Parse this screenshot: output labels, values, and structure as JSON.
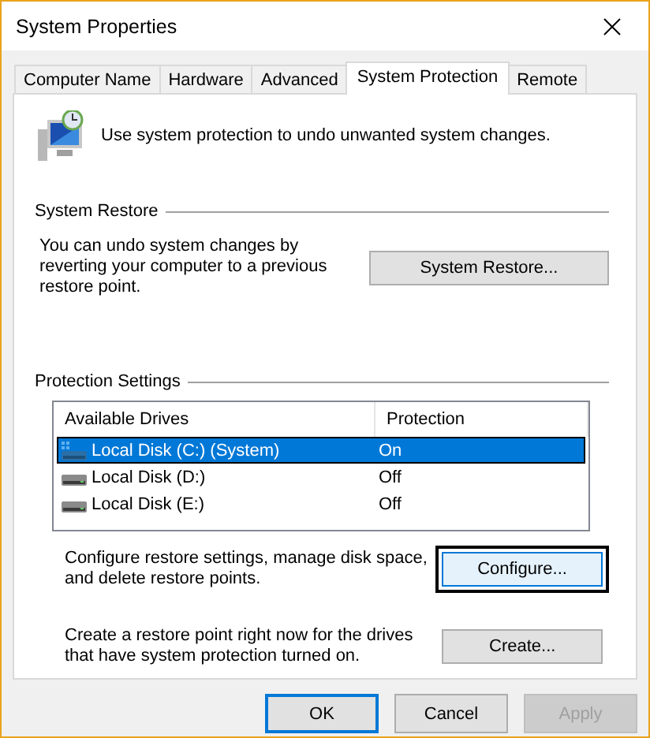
{
  "window": {
    "title": "System Properties"
  },
  "tabs": [
    {
      "label": "Computer Name",
      "selected": false
    },
    {
      "label": "Hardware",
      "selected": false
    },
    {
      "label": "Advanced",
      "selected": false
    },
    {
      "label": "System Protection",
      "selected": true
    },
    {
      "label": "Remote",
      "selected": false
    }
  ],
  "intro": "Use system protection to undo unwanted system changes.",
  "system_restore": {
    "heading": "System Restore",
    "description": "You can undo system changes by reverting your computer to a previous restore point.",
    "button": "System Restore..."
  },
  "protection_settings": {
    "heading": "Protection Settings",
    "columns": [
      "Available Drives",
      "Protection"
    ],
    "drives": [
      {
        "name": "Local Disk (C:) (System)",
        "protection": "On",
        "selected": true,
        "kind": "system"
      },
      {
        "name": "Local Disk (D:)",
        "protection": "Off",
        "selected": false,
        "kind": "disk"
      },
      {
        "name": "Local Disk (E:)",
        "protection": "Off",
        "selected": false,
        "kind": "disk"
      }
    ],
    "configure": {
      "description": "Configure restore settings, manage disk space, and delete restore points.",
      "button": "Configure...",
      "focused": true
    },
    "create": {
      "description": "Create a restore point right now for the drives that have system protection turned on.",
      "button": "Create...",
      "focused": false
    }
  },
  "buttons": [
    {
      "label": "OK",
      "default": true,
      "disabled": false
    },
    {
      "label": "Cancel",
      "default": false,
      "disabled": false
    },
    {
      "label": "Apply",
      "default": false,
      "disabled": true
    }
  ]
}
